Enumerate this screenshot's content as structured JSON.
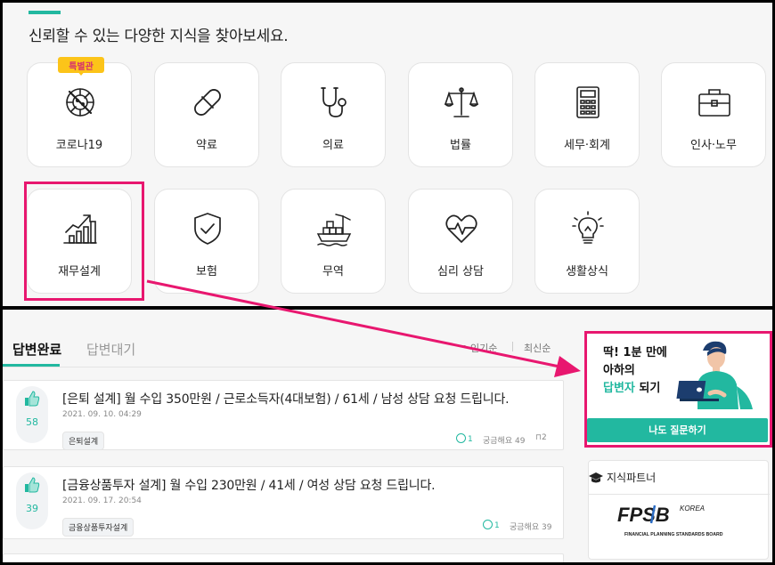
{
  "top": {
    "heading": "신뢰할 수 있는 다양한 지식을 찾아보세요.",
    "badge": "특별관",
    "categories": [
      {
        "label": "코로나19",
        "icon": "virus-icon"
      },
      {
        "label": "약료",
        "icon": "pill-icon"
      },
      {
        "label": "의료",
        "icon": "stethoscope-icon"
      },
      {
        "label": "법률",
        "icon": "scale-icon"
      },
      {
        "label": "세무·회계",
        "icon": "calculator-icon"
      },
      {
        "label": "인사·노무",
        "icon": "briefcase-icon"
      },
      {
        "label": "재무설계",
        "icon": "growth-chart-icon"
      },
      {
        "label": "보험",
        "icon": "shield-check-icon"
      },
      {
        "label": "무역",
        "icon": "cargo-ship-icon"
      },
      {
        "label": "심리 상담",
        "icon": "heartbeat-icon"
      },
      {
        "label": "생활상식",
        "icon": "lightbulb-icon"
      }
    ]
  },
  "tabs": {
    "answered": "답변완료",
    "waiting": "답변대기",
    "sort_popular": "인기순",
    "sort_latest": "최신순"
  },
  "questions": [
    {
      "title": "[은퇴 설계] 월 수입 350만원 / 근로소득자(4대보험) / 61세 / 남성 상담 요청 드립니다.",
      "date": "2021. 09. 10. 04:29",
      "tag": "은퇴설계",
      "likes": "58",
      "answers": "1",
      "curious": "궁금해요 49",
      "bookmarks": "2"
    },
    {
      "title": "[금융상품투자 설계] 월 수입 230만원 / 41세 / 여성 상담 요청 드립니다.",
      "date": "2021. 09. 17. 20:54",
      "tag": "금융상품투자설계",
      "likes": "39",
      "answers": "1",
      "curious": "궁금해요 39"
    }
  ],
  "promo": {
    "line1": "딱! 1분 만에",
    "line2": "아하의",
    "line3_highlight": "답변자",
    "line3_rest": " 되기",
    "button": "나도 질문하기"
  },
  "partner": {
    "heading": "지식파트너",
    "logo_text": "FPSB",
    "logo_country": "KOREA",
    "logo_sub": "FINANCIAL PLANNING STANDARDS BOARD"
  },
  "colors": {
    "accent": "#22b8a0",
    "highlight": "#e8176f",
    "badge": "#fcc419"
  }
}
